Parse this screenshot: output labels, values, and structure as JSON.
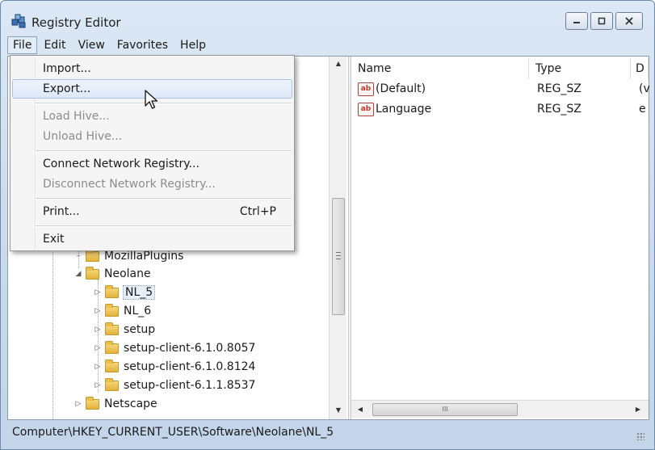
{
  "window": {
    "title": "Registry Editor",
    "icon": "registry-editor-icon"
  },
  "menubar": {
    "items": [
      "File",
      "Edit",
      "View",
      "Favorites",
      "Help"
    ],
    "active": "File"
  },
  "file_menu": {
    "items": [
      {
        "label": "Import...",
        "enabled": true
      },
      {
        "label": "Export...",
        "enabled": true,
        "highlighted": true
      },
      {
        "label": "Load Hive...",
        "enabled": false
      },
      {
        "label": "Unload Hive...",
        "enabled": false
      },
      {
        "label": "Connect Network Registry...",
        "enabled": true
      },
      {
        "label": "Disconnect Network Registry...",
        "enabled": false
      },
      {
        "label": "Print...",
        "enabled": true,
        "shortcut": "Ctrl+P"
      },
      {
        "label": "Exit",
        "enabled": true
      }
    ]
  },
  "tree": {
    "items": [
      {
        "label": "MozillaPlugins",
        "expander": "none"
      },
      {
        "label": "Neolane",
        "expander": "expanded"
      },
      {
        "label": "NL_5",
        "expander": "collapsed",
        "selected": true
      },
      {
        "label": "NL_6",
        "expander": "collapsed"
      },
      {
        "label": "setup",
        "expander": "collapsed"
      },
      {
        "label": "setup-client-6.1.0.8057",
        "expander": "collapsed"
      },
      {
        "label": "setup-client-6.1.0.8124",
        "expander": "collapsed"
      },
      {
        "label": "setup-client-6.1.1.8537",
        "expander": "collapsed"
      },
      {
        "label": "Netscape",
        "expander": "collapsed"
      }
    ]
  },
  "values": {
    "columns": [
      "Name",
      "Type",
      "D"
    ],
    "rows": [
      {
        "name": "(Default)",
        "type": "REG_SZ",
        "data": "(v",
        "icon": "string-value-icon"
      },
      {
        "name": "Language",
        "type": "REG_SZ",
        "data": "e",
        "icon": "string-value-icon"
      }
    ],
    "icon_text": "ab"
  },
  "hscroll": {
    "thumb_glyph": "III"
  },
  "status": {
    "path": "Computer\\HKEY_CURRENT_USER\\Software\\Neolane\\NL_5"
  }
}
